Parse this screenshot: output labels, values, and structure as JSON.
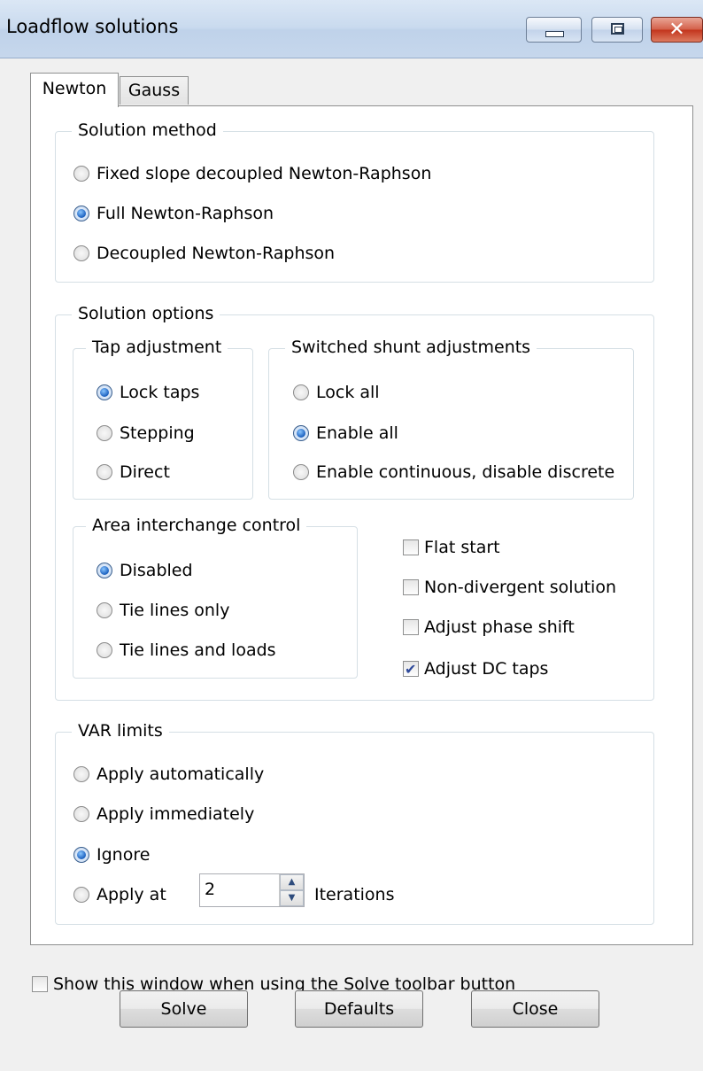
{
  "window": {
    "title": "Loadflow solutions",
    "close_glyph": "✕"
  },
  "tabs": [
    {
      "label": "Newton",
      "selected": true
    },
    {
      "label": "Gauss",
      "selected": false
    }
  ],
  "solution_method": {
    "title": "Solution method",
    "options": [
      {
        "label": "Fixed slope decoupled Newton-Raphson",
        "selected": false
      },
      {
        "label": "Full Newton-Raphson",
        "selected": true
      },
      {
        "label": "Decoupled Newton-Raphson",
        "selected": false
      }
    ]
  },
  "solution_options": {
    "title": "Solution options",
    "tap_adjustment": {
      "title": "Tap adjustment",
      "options": [
        {
          "label": "Lock taps",
          "selected": true
        },
        {
          "label": "Stepping",
          "selected": false
        },
        {
          "label": "Direct",
          "selected": false
        }
      ]
    },
    "switched_shunt": {
      "title": "Switched shunt adjustments",
      "options": [
        {
          "label": "Lock all",
          "selected": false
        },
        {
          "label": "Enable all",
          "selected": true
        },
        {
          "label": "Enable continuous, disable discrete",
          "selected": false
        }
      ]
    },
    "area_interchange": {
      "title": "Area interchange control",
      "options": [
        {
          "label": "Disabled",
          "selected": true
        },
        {
          "label": "Tie lines only",
          "selected": false
        },
        {
          "label": "Tie lines and loads",
          "selected": false
        }
      ]
    },
    "checkboxes": [
      {
        "label": "Flat start",
        "checked": false
      },
      {
        "label": "Non-divergent solution",
        "checked": false
      },
      {
        "label": "Adjust phase shift",
        "checked": false
      },
      {
        "label": "Adjust DC taps",
        "checked": true
      }
    ]
  },
  "var_limits": {
    "title": "VAR limits",
    "options": [
      {
        "label": "Apply automatically",
        "selected": false
      },
      {
        "label": "Apply immediately",
        "selected": false
      },
      {
        "label": "Ignore",
        "selected": true
      },
      {
        "label": "Apply at",
        "selected": false
      }
    ],
    "iterations_value": "2",
    "iterations_label": "Iterations"
  },
  "footer": {
    "show_window_label": "Show this window when using the Solve toolbar button",
    "show_window_checked": false,
    "solve_label": "Solve",
    "defaults_label": "Defaults",
    "close_label": "Close"
  }
}
